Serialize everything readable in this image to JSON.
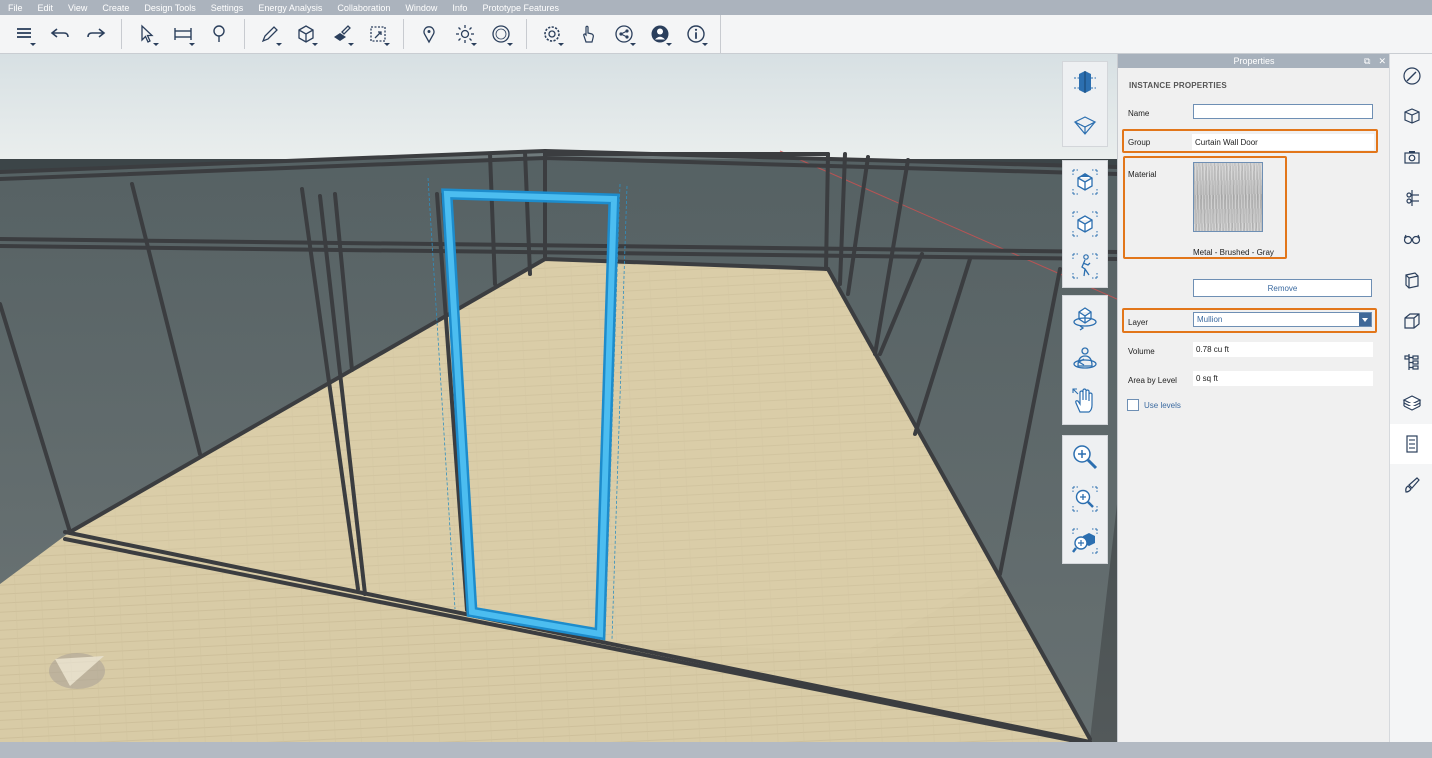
{
  "menu": {
    "items": [
      {
        "id": "file",
        "label": "File"
      },
      {
        "id": "edit",
        "label": "Edit"
      },
      {
        "id": "view",
        "label": "View"
      },
      {
        "id": "create",
        "label": "Create"
      },
      {
        "id": "design-tools",
        "label": "Design Tools"
      },
      {
        "id": "settings",
        "label": "Settings"
      },
      {
        "id": "energy-analysis",
        "label": "Energy Analysis"
      },
      {
        "id": "collaboration",
        "label": "Collaboration"
      },
      {
        "id": "window",
        "label": "Window"
      },
      {
        "id": "info",
        "label": "Info"
      },
      {
        "id": "prototype-features",
        "label": "Prototype Features"
      }
    ]
  },
  "toolbar": {
    "icons": [
      "list-menu-icon",
      "undo-icon",
      "redo-icon",
      "select-arrow-icon",
      "measure-tape-icon",
      "paint-bucket-icon",
      "sketch-pencil-icon",
      "cube-create-icon",
      "geometry-edit-icon",
      "group-select-icon",
      "location-pin-icon",
      "sun-settings-icon",
      "dimension-icon",
      "settings-gear-icon",
      "touch-gesture-icon",
      "share-icon",
      "user-account-icon",
      "info-icon"
    ]
  },
  "navigation": {
    "icons": [
      "top-view-icon",
      "bottom-view-icon",
      "home-view-icon",
      "perspective-view-icon",
      "walk-mode-icon",
      "orbit-icon",
      "look-around-icon",
      "pan-hand-icon",
      "zoom-in-icon",
      "zoom-region-icon",
      "zoom-extents-icon"
    ]
  },
  "properties": {
    "panel_title": "Properties",
    "section_title": "INSTANCE PROPERTIES",
    "name_label": "Name",
    "name_value": "",
    "group_label": "Group",
    "group_value": "Curtain Wall Door",
    "material_label": "Material",
    "material_name": "Metal - Brushed - Gray",
    "remove_label": "Remove",
    "layer_label": "Layer",
    "layer_value": "Mullion",
    "volume_label": "Volume",
    "volume_value": "0.78 cu ft",
    "area_label": "Area by Level",
    "area_value": "0 sq ft",
    "use_levels_label": "Use levels",
    "use_levels_checked": false
  },
  "rail": {
    "icons": [
      "style-brush-icon",
      "material-cube-icon",
      "camera-scene-icon",
      "snapshot-icon",
      "glasses-view-icon",
      "section-cube-icon",
      "level-box-icon",
      "tree-hierarchy-icon",
      "layers-stack-icon",
      "properties-panel-icon",
      "paint-brush-icon"
    ],
    "active": "properties-panel-icon"
  },
  "colors": {
    "selection": "#2fa8e0",
    "highlight": "#e2761a",
    "accent": "#3f6898"
  }
}
